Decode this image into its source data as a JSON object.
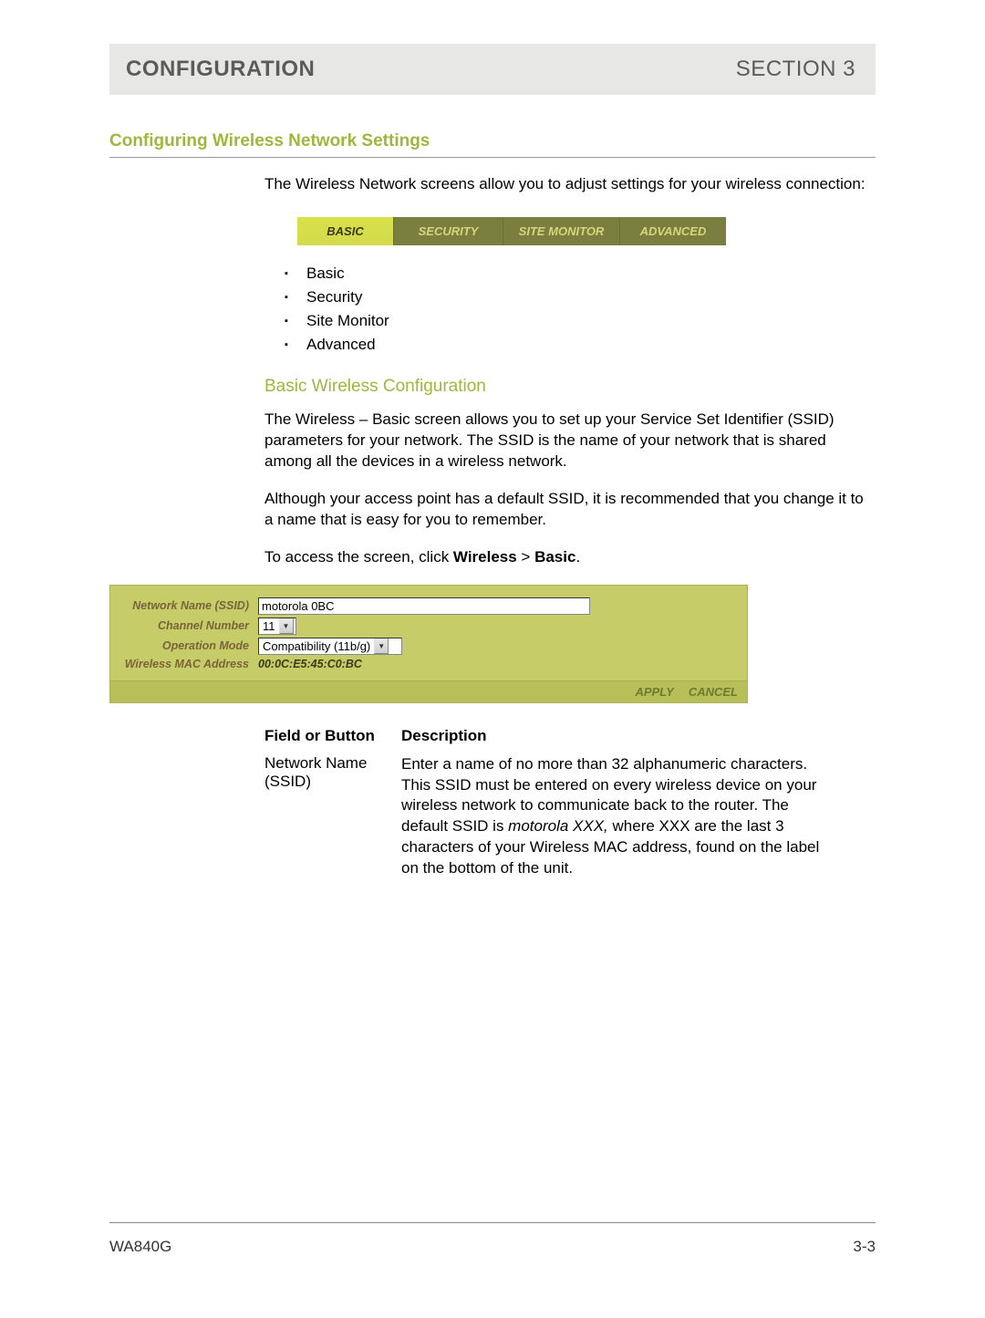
{
  "header": {
    "left": "CONFIGURATION",
    "right": "SECTION 3"
  },
  "section_title": "Configuring Wireless Network Settings",
  "intro": "The Wireless Network screens allow you to adjust settings for your wireless connection:",
  "tabs": {
    "active": "BASIC",
    "others": [
      "SECURITY",
      "SITE MONITOR",
      "ADVANCED"
    ]
  },
  "bullets": [
    "Basic",
    "Security",
    "Site Monitor",
    "Advanced"
  ],
  "subheading": "Basic Wireless Configuration",
  "para2": "The Wireless – Basic screen allows you to set up your Service Set Identifier (SSID) parameters for your network. The SSID is the name of your network that is shared among all the devices in a wireless network.",
  "para3": "Although your access point has a default SSID, it is recommended that you change it to a name that is easy for you to remember.",
  "para4_pre": "To access the screen, click ",
  "para4_b1": "Wireless",
  "para4_sep": " > ",
  "para4_b2": "Basic",
  "para4_post": ".",
  "form": {
    "labels": {
      "ssid": "Network Name (SSID)",
      "channel": "Channel Number",
      "mode": "Operation Mode",
      "mac": "Wireless MAC Address"
    },
    "values": {
      "ssid": "motorola 0BC",
      "channel": "11",
      "mode": "Compatibility (11b/g)",
      "mac": "00:0C:E5:45:C0:BC"
    },
    "buttons": {
      "apply": "APPLY",
      "cancel": "CANCEL"
    }
  },
  "desc": {
    "h1": "Field or Button",
    "h2": "Description",
    "r1c1": "Network Name (SSID)",
    "r1c2_a": "Enter a name of no more than 32 alphanumeric characters. This SSID must be entered on every wireless device on your wireless network to communicate back to the router. The default SSID is ",
    "r1c2_i": "motorola XXX,",
    "r1c2_b": " where XXX are the last 3 characters of your Wireless MAC address, found on the label on the bottom of the unit."
  },
  "footer": {
    "left": "WA840G",
    "right": "3-3"
  }
}
